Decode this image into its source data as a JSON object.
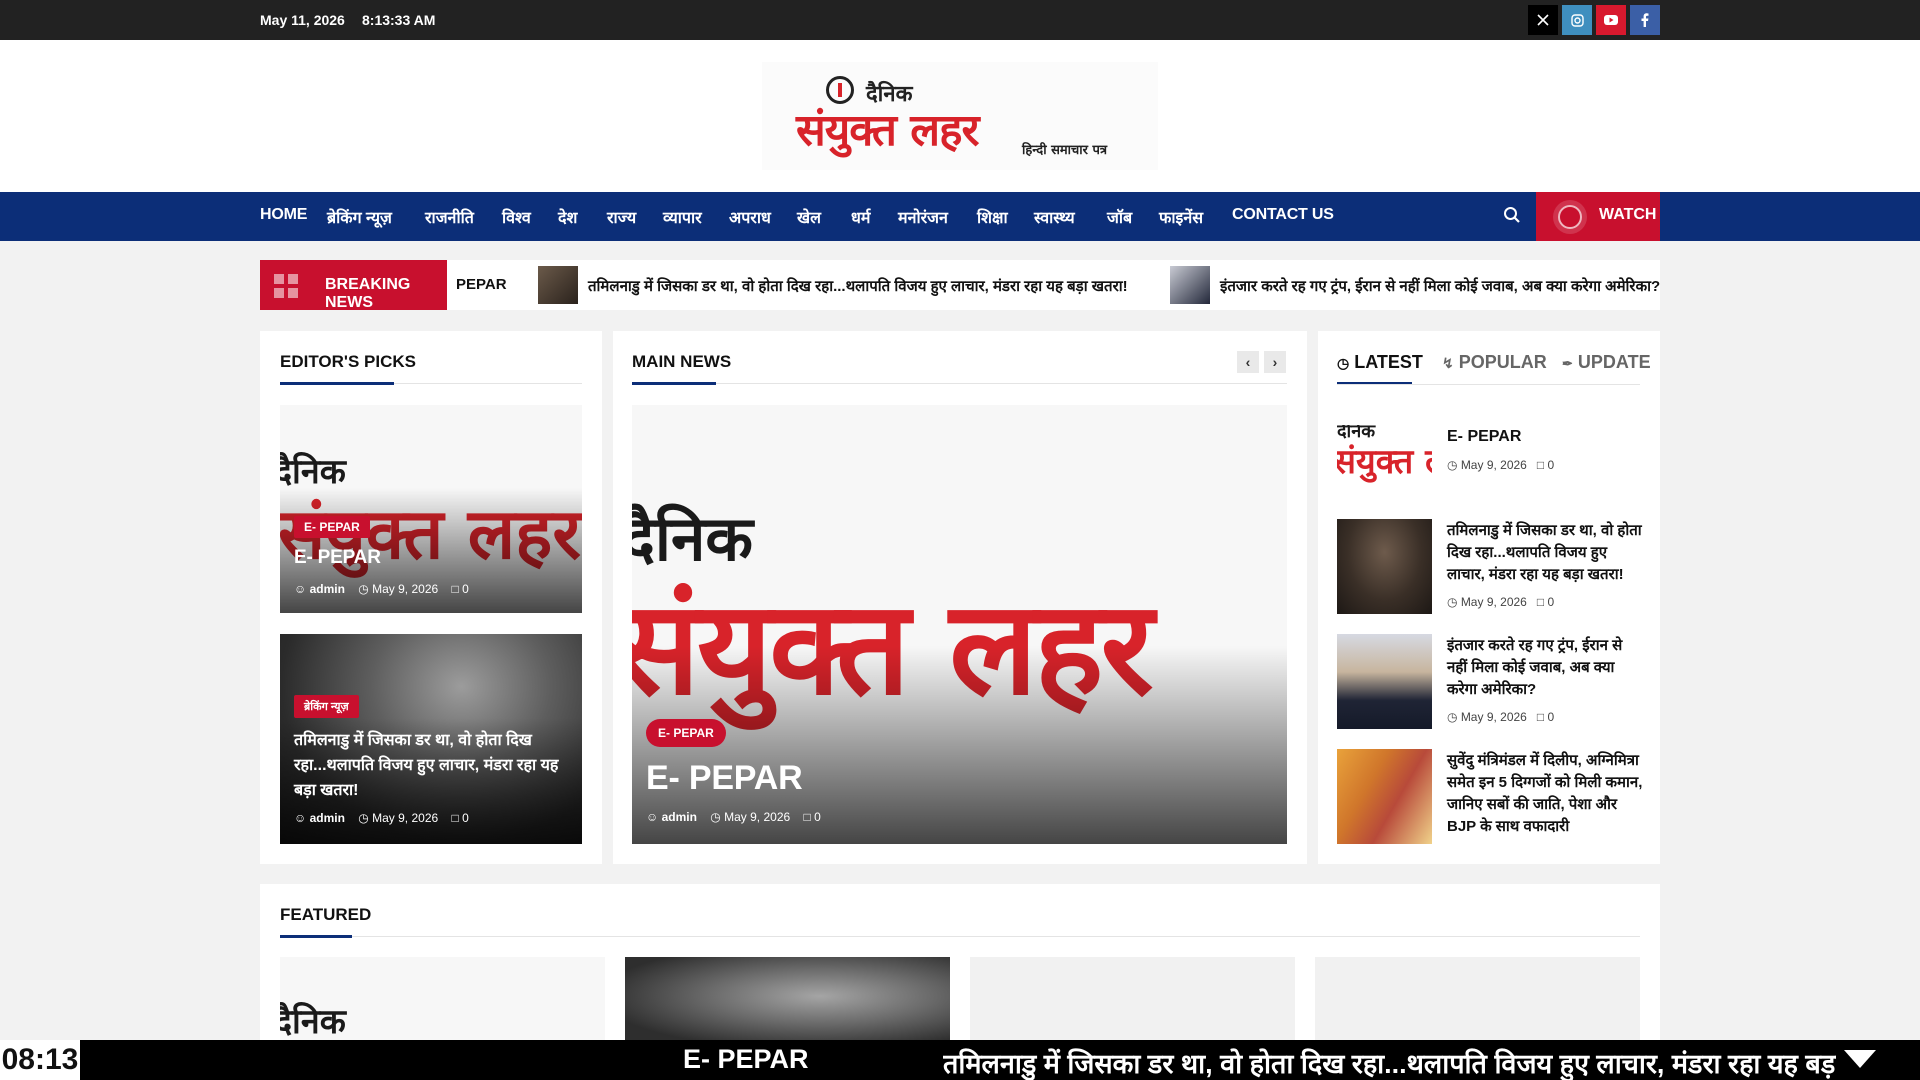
{
  "topbar": {
    "date": "May 11, 2026",
    "time": "8:13:33 AM"
  },
  "social": [
    "x-icon",
    "instagram-icon",
    "youtube-icon",
    "facebook-icon"
  ],
  "logo": {
    "line1": "दैनिक",
    "line2": "संयुक्त लहर",
    "tagline": "हिन्दी समाचार पत्र"
  },
  "nav": {
    "items": [
      "HOME",
      "ब्रेकिंग न्यूज़",
      "राजनीति",
      "विश्व",
      "देश",
      "राज्य",
      "व्यापार",
      "अपराध",
      "खेल",
      "धर्म",
      "मनोरंजन",
      "शिक्षा",
      "स्वास्थ्य",
      "जॉब",
      "फाइनेंस",
      "CONTACT US"
    ],
    "watch": "WATCH"
  },
  "breaking": {
    "label": "BREAKING NEWS",
    "items": [
      "PEPAR",
      "तमिलनाडु में जिसका डर था, वो होता दिख रहा...थलापति विजय हुए लाचार, मंडरा रहा यह बड़ा खतरा!",
      "इंतजार करते रह गए ट्रंप, ईरान से नहीं मिला कोई जवाब, अब क्या करेगा अमेरिका?"
    ]
  },
  "editors": {
    "title": "EDITOR'S PICKS",
    "cards": [
      {
        "category": "E- PEPAR",
        "title": "E- PEPAR",
        "author": "admin",
        "date": "May 9, 2026",
        "comments": "0"
      },
      {
        "category": "ब्रेकिंग न्यूज़",
        "title": "तमिलनाडु में जिसका डर था, वो होता दिख रहा...थलापति विजय हुए लाचार, मंडरा रहा यह बड़ा खतरा!",
        "author": "admin",
        "date": "May 9, 2026",
        "comments": "0"
      }
    ]
  },
  "main": {
    "title": "MAIN NEWS",
    "card": {
      "category": "E- PEPAR",
      "title": "E- PEPAR",
      "author": "admin",
      "date": "May 9, 2026",
      "comments": "0"
    }
  },
  "tabs": {
    "latest": "LATEST",
    "popular": "POPULAR",
    "update": "UPDATE"
  },
  "latest": [
    {
      "title": "E- PEPAR",
      "date": "May 9, 2026",
      "comments": "0"
    },
    {
      "title": "तमिलनाडु में जिसका डर था, वो होता दिख रहा...थलापति विजय हुए लाचार, मंडरा रहा यह बड़ा खतरा!",
      "date": "May 9, 2026",
      "comments": "0"
    },
    {
      "title": "इंतजार करते रह गए ट्रंप, ईरान से नहीं मिला कोई जवाब, अब क्या करेगा अमेरिका?",
      "date": "May 9, 2026",
      "comments": "0"
    },
    {
      "title": "सुवेंदु मंत्रिमंडल में दिलीप, अग्निमित्रा समेत इन 5 दिग्गजों को मिली कमान, जानिए सबों की जाति, पेशा और BJP के साथ वफादारी",
      "date": "",
      "comments": ""
    }
  ],
  "featured": {
    "title": "FEATURED"
  },
  "bottom": {
    "clock": "08:13",
    "item1": "E- PEPAR",
    "item2": "तमिलनाडु में जिसका डर था, वो होता दिख रहा...थलापति विजय हुए लाचार, मंडरा रहा यह बड़ा"
  },
  "colors": {
    "nav": "#0c2e78",
    "accent": "#c8102e",
    "topbar": "#222222"
  }
}
